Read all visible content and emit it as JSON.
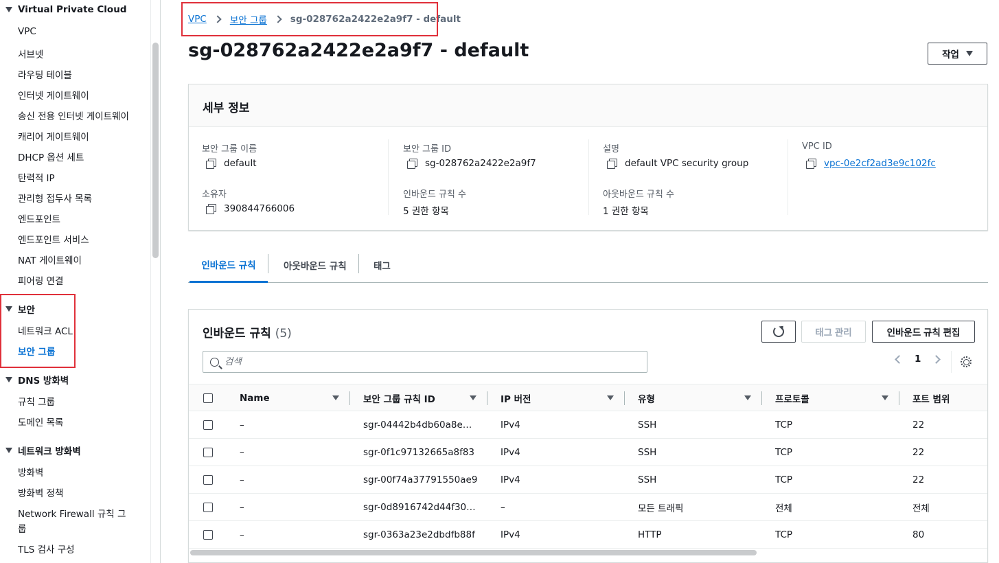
{
  "sidebar": {
    "sections": [
      {
        "label": "Virtual Private Cloud",
        "items": [
          "VPC",
          "서브넷",
          "라우팅 테이블",
          "인터넷 게이트웨이",
          "송신 전용 인터넷 게이트웨이",
          "캐리어 게이트웨이",
          "DHCP 옵션 세트",
          "탄력적 IP",
          "관리형 접두사 목록",
          "엔드포인트",
          "엔드포인트 서비스",
          "NAT 게이트웨이",
          "피어링 연결"
        ]
      },
      {
        "label": "보안",
        "items": [
          "네트워크 ACL",
          "보안 그룹"
        ]
      },
      {
        "label": "DNS 방화벽",
        "items": [
          "규칙 그룹",
          "도메인 목록"
        ]
      },
      {
        "label": "네트워크 방화벽",
        "items": [
          "방화벽",
          "방화벽 정책",
          "Network Firewall 규칙 그",
          "룹",
          "TLS 검사 구성"
        ]
      }
    ]
  },
  "breadcrumb": {
    "vpc": "VPC",
    "sg": "보안 그룹",
    "current": "sg-028762a2422e2a9f7 - default"
  },
  "page": {
    "title": "sg-028762a2422e2a9f7 - default",
    "action_label": "작업"
  },
  "details": {
    "header": "세부 정보",
    "sg_name_label": "보안 그룹 이름",
    "sg_name": "default",
    "sg_id_label": "보안 그룹 ID",
    "sg_id": "sg-028762a2422e2a9f7",
    "desc_label": "설명",
    "desc": "default VPC security group",
    "vpc_id_label": "VPC ID",
    "vpc_id": "vpc-0e2cf2ad3e9c102fc",
    "owner_label": "소유자",
    "owner": "390844766006",
    "inbound_count_label": "인바운드 규칙 수",
    "inbound_count": "5 권한 항목",
    "outbound_count_label": "아웃바운드 규칙 수",
    "outbound_count": "1 권한 항목"
  },
  "tabs": {
    "inbound": "인바운드 규칙",
    "outbound": "아웃바운드 규칙",
    "tags": "태그"
  },
  "rules": {
    "title": "인바운드 규칙",
    "count": "(5)",
    "manage_tags": "태그 관리",
    "edit_inbound": "인바운드 규칙 편집",
    "search_placeholder": "검색",
    "page": "1",
    "columns": [
      "Name",
      "보안 그룹 규칙 ID",
      "IP 버전",
      "유형",
      "프로토콜",
      "포트 범위"
    ],
    "rows": [
      [
        "–",
        "sgr-04442b4db60a8e…",
        "IPv4",
        "SSH",
        "TCP",
        "22"
      ],
      [
        "–",
        "sgr-0f1c97132665a8f83",
        "IPv4",
        "SSH",
        "TCP",
        "22"
      ],
      [
        "–",
        "sgr-00f74a37791550ae9",
        "IPv4",
        "SSH",
        "TCP",
        "22"
      ],
      [
        "–",
        "sgr-0d8916742d44f30…",
        "–",
        "모든 트래픽",
        "전체",
        "전체"
      ],
      [
        "–",
        "sgr-0363a23e2dbdfb88f",
        "IPv4",
        "HTTP",
        "TCP",
        "80"
      ]
    ]
  }
}
